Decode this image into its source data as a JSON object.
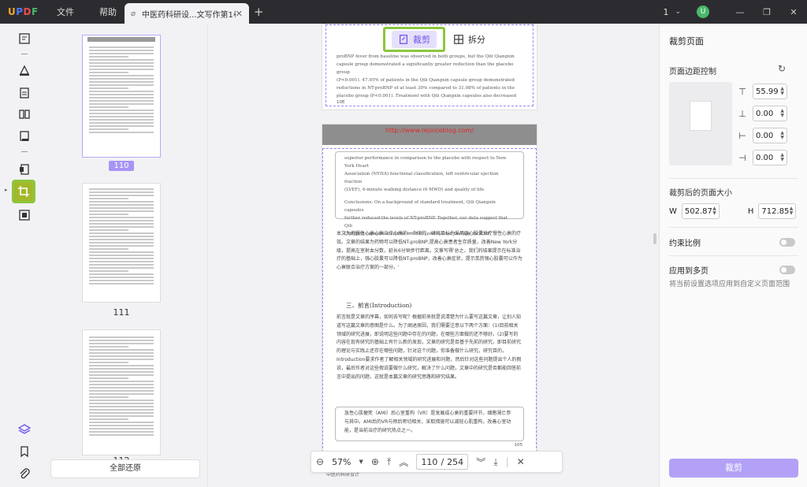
{
  "app": {
    "logo": "UPDF",
    "menu": [
      "文件",
      "帮助"
    ],
    "tab_title": "中医药科研设...文写作第1卷",
    "page_count_label": "1",
    "avatar_letter": "U"
  },
  "mode": {
    "crop": "裁剪",
    "split": "拆分"
  },
  "thumbnails": [
    {
      "label": "110",
      "selected": true
    },
    {
      "label": "111",
      "selected": false
    },
    {
      "label": "112",
      "selected": false
    }
  ],
  "restore_all": "全部还原",
  "page": {
    "url": "http://www.rejoiceblog.com/",
    "prev_lines": [
      "proBNP fever from baseline was observed in both groups, but the Qili Qiangxin",
      "capsule group demonstrated a significantly greater reduction than the placebo group",
      "(P<0.001). 47.95% of patients in the Qili Qiangxin capsule group demonstrated",
      "reductions in NT-proBNP of at least 30% compared to 31.98% of patients in the",
      "placebo group (P<0.001). Treatment with Qili Qiangxin capsules also decreased"
    ],
    "prev_page_num": "10E",
    "boxed_lines": [
      "superior performance in comparison to the placebo with respect to New York Heart",
      "Association (NYHA) functional classification, left ventricular ejection fraction",
      "(LVEF), 6-minute walking distance (6 MWD) and quality of life.",
      "Conclusions: On a background of standard treatment, Qili Qiangxin capsules",
      "further reduced the levels of NT-proBNP. Together, our data suggest that Qili",
      "Qiangxin capsules could be used in combination therapy for CHF."
    ],
    "cn_paragraph_1": "本文为把慢性心衰心衰治疗心衰的一个研究，研究目标为采用强心胶囊治疗慢性心衰的疗效。文章的结果为药物可以降低NT-proBNP,提高心衰患者生存质量，改善New York分级，提高左室射血分数，延长6分钟步行距离。文章写得'总之，我们的结果提示在标准治疗的基础上，强心胶囊可以降低NT-proBNP，改善心衰症状，提示芪苈强心胶囊可以作为心衰联合治疗方案的一部分。'",
    "section_title": "三、前言(Introduction)",
    "cn_paragraph_2": "前言就是文章的序幕，如何去写呢？根据前来就是说清楚为什么要写这篇文章，让别人知道写这篇文章的意图是什么。为了阐述原因，我们需要注意以下两个方面：(1)目前相关领域的研究进展，即说明这些问题中存在的问题，在哪些方面做的还不够好。(2)要写的内容在现有研究的基础上有什么新的发现，文章的研究是否基于先前的研究，即目前研究的理论与实践上还存在哪些问题，针对这个问题，你准备做什么研究，研究目的，Introduction要求作者了解相关领域的研究进展和问题，然后针对这些问题提出个人的假说，最后作者对这些假说要做什么研究，解决了什么问题，文章中的研究是否都能回答前言中提出的问题，这就是本篇文章的研究思路和研究结果。",
    "cn_boxed": "急性心肌梗死（AMI）后心室重构（VR）是发展成心衰的重要环节，细胞凋亡参与其中。AMI后的VR与预后密切相关，采取措施可以减轻心肌重构，改善心室功能，是当前治疗的研究热点之一。",
    "page_num": "105",
    "footer_logo": "中医药科研设计"
  },
  "zoom": {
    "level": "57%",
    "current_page": "110",
    "total_pages": "254"
  },
  "panel": {
    "title": "裁剪页面",
    "margin_label": "页面边距控制",
    "margins": {
      "top": "55.99",
      "bottom": "0.00",
      "left": "0.00",
      "right": "0.00"
    },
    "size_label": "裁剪后的页面大小",
    "width_label": "W",
    "width": "502.87",
    "height_label": "H",
    "height": "712.85",
    "aspect_label": "约束比例",
    "apply_multi_label": "应用到多页",
    "apply_hint": "将当前设置选项应用到自定义页面范围",
    "crop_button": "裁剪"
  }
}
